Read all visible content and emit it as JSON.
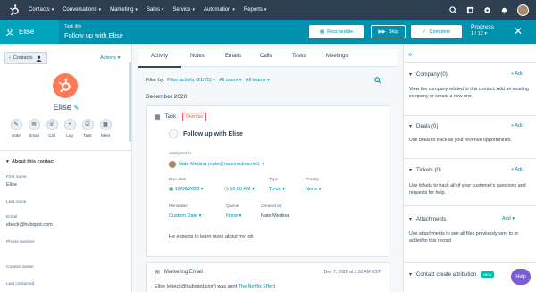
{
  "nav": {
    "items": [
      "Contacts",
      "Conversations",
      "Marketing",
      "Sales",
      "Service",
      "Automation",
      "Reports"
    ]
  },
  "taskbar": {
    "record_name": "Elise",
    "task_title_label": "Task title",
    "task_title": "Follow up with Elise",
    "reschedule": "Reschedule",
    "skip": "Skip",
    "complete": "Complete",
    "progress_label": "Progress",
    "progress_value": "1 / 12"
  },
  "left": {
    "contacts_button": "Contacts",
    "actions": "Actions",
    "name": "Elise",
    "quick_actions": [
      "Note",
      "Email",
      "Call",
      "Log",
      "Task",
      "Meet"
    ],
    "about_title": "About this contact",
    "fields": [
      {
        "label": "First name",
        "value": "Elise"
      },
      {
        "label": "Last name",
        "value": ""
      },
      {
        "label": "Email",
        "value": "ebeck@hubspot.com"
      },
      {
        "label": "Phone number",
        "value": ""
      },
      {
        "label": "Contact owner",
        "value": ""
      },
      {
        "label": "Last contacted",
        "value": ""
      }
    ]
  },
  "middle": {
    "tabs": [
      "Activity",
      "Notes",
      "Emails",
      "Calls",
      "Tasks",
      "Meetings"
    ],
    "filter_by": "Filter by:",
    "filter_activity": "Filter activity (21/25)",
    "all_users": "All users",
    "all_teams": "All teams",
    "month": "December 2020",
    "task_card": {
      "type": "Task",
      "status": "Overdue",
      "title": "Follow up with Elise",
      "assigned_label": "Assigned to",
      "assigned_value": "Nate Medina (nate@natemedina.net)",
      "due_label": "Due date",
      "due_date": "12/08/2020",
      "due_time": "10:00 AM",
      "type_label": "Type",
      "type_value": "To-do",
      "priority_label": "Priority",
      "priority_value": "None",
      "reminder_label": "Reminder",
      "reminder_value": "Custom Date",
      "queue_label": "Queue",
      "queue_value": "None",
      "created_label": "Created by",
      "created_value": "Nate Medina",
      "body": "He expects to learn more about my job"
    },
    "email_card": {
      "type": "Marketing Email",
      "timestamp": "Dec 7, 2020 at 3:30 AM EST",
      "text": "Elise (ebeck@hubspot.com) was sent",
      "link": "The Netflix Effect"
    }
  },
  "right": {
    "sections": [
      {
        "title": "Company (0)",
        "add": "+ Add",
        "desc": "View the company related to this contact. Add an existing company or create a new one."
      },
      {
        "title": "Deals (0)",
        "add": "+ Add",
        "desc": "Use deals to track all your revenue opportunities."
      },
      {
        "title": "Tickets (0)",
        "add": "+ Add",
        "desc": "Use tickets to track all of your customer's questions and requests for help."
      },
      {
        "title": "Attachments",
        "add": "Add",
        "desc": "Use attachments to see all files previously sent to or added to this record"
      },
      {
        "title": "Contact create attribution",
        "badge": "NEW",
        "desc": ""
      }
    ],
    "help": "Help"
  },
  "colors": {
    "nav": "#2d3e50",
    "taskbar": "#0091ae",
    "accent": "#ff7a59",
    "link": "#0091ae"
  }
}
